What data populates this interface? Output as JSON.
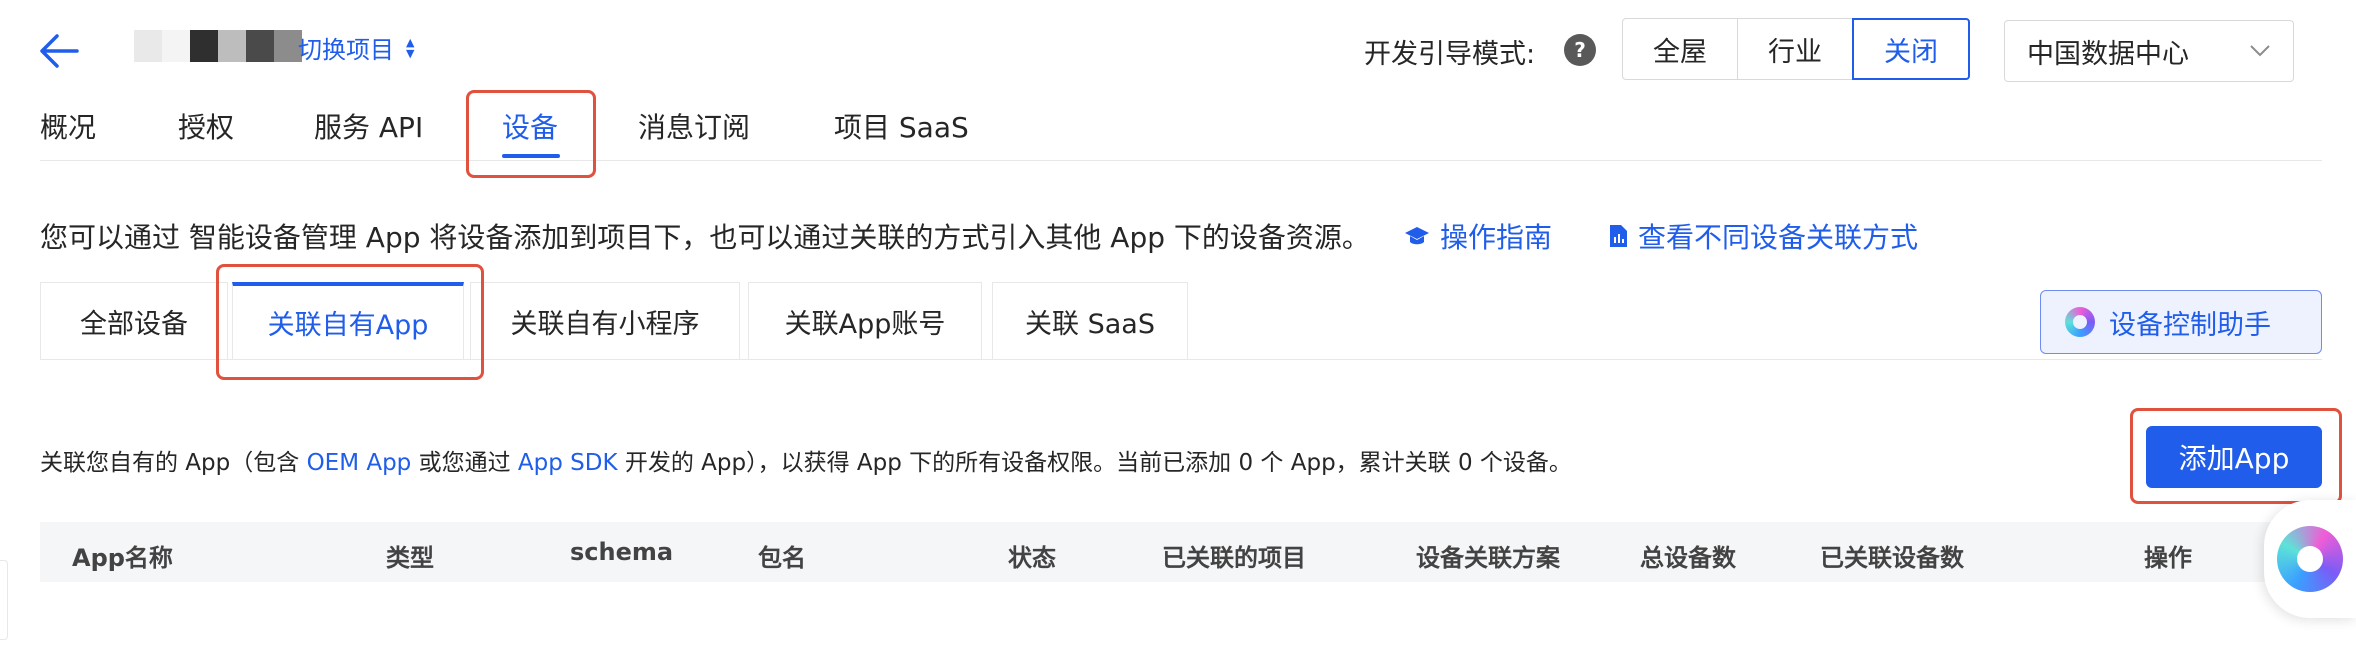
{
  "header": {
    "switch_project_label": "切换项目",
    "guide_mode_label": "开发引导模式:",
    "guide_modes": [
      "全屋",
      "行业",
      "关闭"
    ],
    "region": "中国数据中心"
  },
  "top_tabs": [
    "概况",
    "授权",
    "服务 API",
    "设备",
    "消息订阅",
    "项目 SaaS"
  ],
  "description": {
    "text": "您可以通过 智能设备管理 App 将设备添加到项目下，也可以通过关联的方式引入其他 App 下的设备资源。",
    "guide_link": "操作指南",
    "methods_link": "查看不同设备关联方式"
  },
  "sub_tabs": [
    "全部设备",
    "关联自有App",
    "关联自有小程序",
    "关联App账号",
    "关联 SaaS"
  ],
  "assistant_label": "设备控制助手",
  "info": {
    "part1": "关联您自有的 App（包含 ",
    "oem_link": "OEM App",
    "part2": " 或您通过 ",
    "sdk_link": "App SDK",
    "part3": " 开发的 App），以获得 App 下的所有设备权限。当前已添加 0 个 App，累计关联 0 个设备。"
  },
  "add_app_label": "添加App",
  "table": {
    "columns": [
      "App名称",
      "类型",
      "schema",
      "包名",
      "状态",
      "已关联的项目",
      "设备关联方案",
      "总设备数",
      "已关联设备数",
      "操作"
    ]
  },
  "colors": {
    "accent": "#1f5dea",
    "highlight": "#e0513e"
  }
}
